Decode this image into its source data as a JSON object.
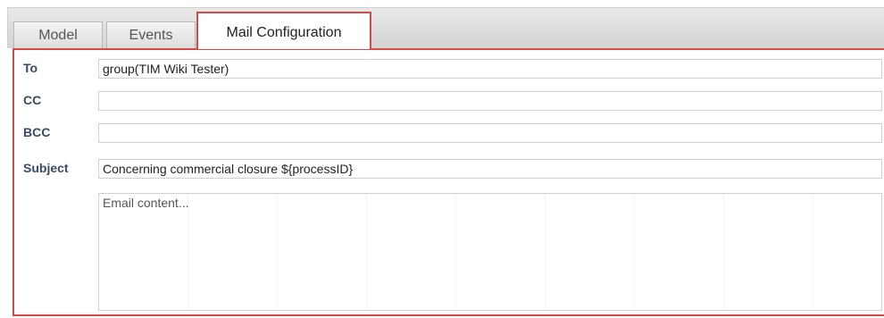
{
  "tabs": {
    "model": "Model",
    "events": "Events",
    "mail_configuration": "Mail Configuration"
  },
  "mail": {
    "to_label": "To",
    "to_value": "group(TIM Wiki Tester)",
    "cc_label": "CC",
    "cc_value": "",
    "bcc_label": "BCC",
    "bcc_value": "",
    "subject_label": "Subject",
    "subject_value": "Concerning commercial closure ${processID}",
    "body_placeholder": "Email content..."
  },
  "colors": {
    "active_border": "#d94848",
    "label_text": "#3a4a66"
  }
}
